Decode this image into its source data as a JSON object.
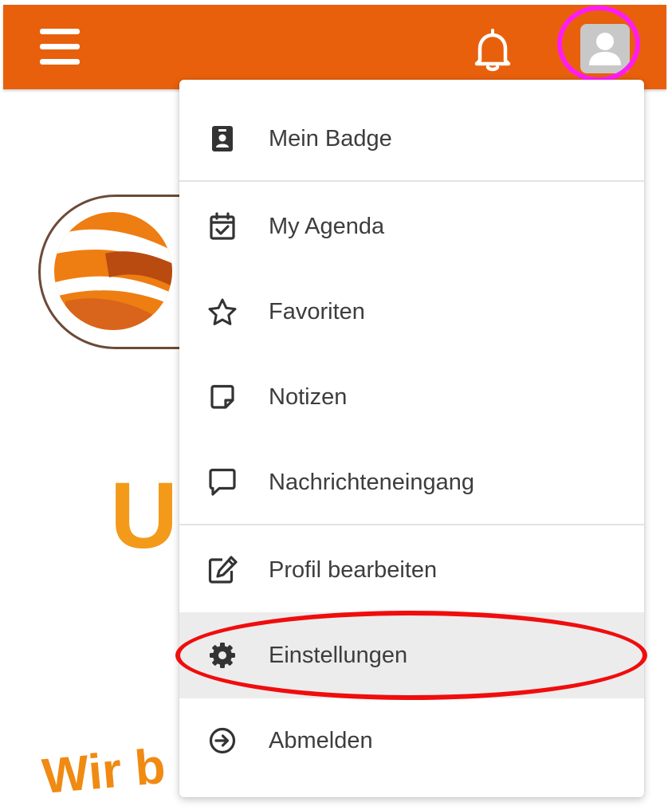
{
  "header": {
    "menu_icon": "hamburger-menu-icon",
    "notification_icon": "bell-icon",
    "profile_icon": "user-avatar-icon",
    "background_color": "#e8600c"
  },
  "background": {
    "heading_fragment": "U",
    "subheading_fragment": "Wir b",
    "logo_icon": "globe-logo-icon"
  },
  "profile_menu": {
    "items": [
      {
        "label": "Mein Badge",
        "icon": "badge-icon"
      },
      {
        "label": "My Agenda",
        "icon": "calendar-check-icon"
      },
      {
        "label": "Favoriten",
        "icon": "star-icon"
      },
      {
        "label": "Notizen",
        "icon": "sticky-note-icon"
      },
      {
        "label": "Nachrichteneingang",
        "icon": "message-icon"
      },
      {
        "label": "Profil bearbeiten",
        "icon": "edit-icon"
      },
      {
        "label": "Einstellungen",
        "icon": "gear-icon",
        "highlighted": true
      },
      {
        "label": "Abmelden",
        "icon": "logout-arrow-icon"
      }
    ]
  },
  "annotations": {
    "avatar_circle_color": "#ff1cf4",
    "settings_circle_color": "#f00d0d"
  }
}
